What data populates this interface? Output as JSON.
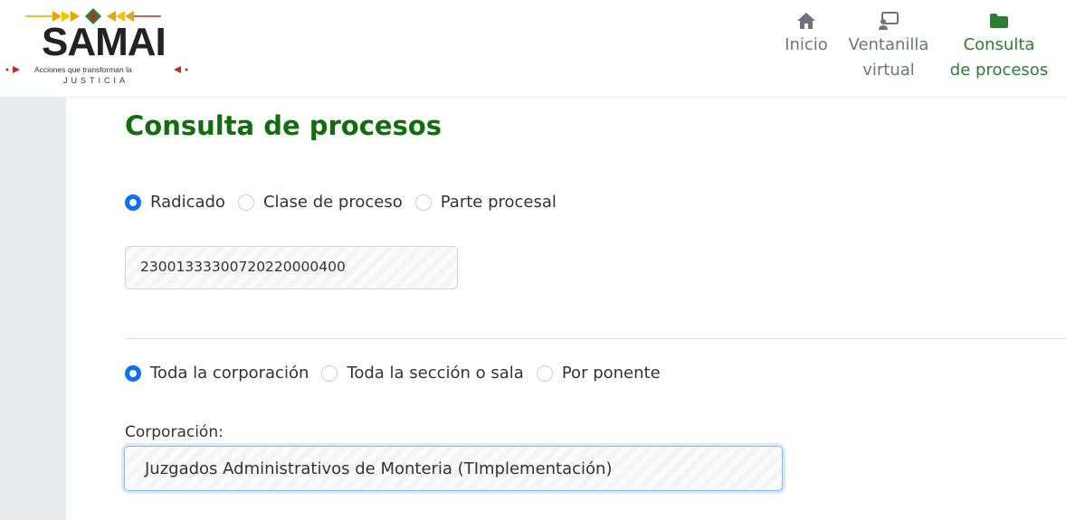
{
  "logo": {
    "title": "SAMAI",
    "tagline": "Acciones que transforman la",
    "subtitle": "JUSTICIA"
  },
  "nav": {
    "items": [
      {
        "label_line1": "Inicio",
        "label_line2": "",
        "icon": "home-icon",
        "active": false
      },
      {
        "label_line1": "Ventanilla",
        "label_line2": "virtual",
        "icon": "desktop-user-icon",
        "active": false
      },
      {
        "label_line1": "Consulta",
        "label_line2": "de procesos",
        "icon": "folder-icon",
        "active": true
      }
    ]
  },
  "page": {
    "title": "Consulta de procesos"
  },
  "search_type": {
    "options": [
      "Radicado",
      "Clase de proceso",
      "Parte procesal"
    ],
    "selected": "Radicado"
  },
  "radicado_input": {
    "value": "23001333300720220000400"
  },
  "scope": {
    "options": [
      "Toda la corporación",
      "Toda la sección o sala",
      "Por ponente"
    ],
    "selected": "Toda la corporación"
  },
  "corporacion": {
    "label": "Corporación:",
    "value": "Juzgados Administrativos de Monteria (TImplementación)"
  },
  "colors": {
    "accent_green": "#116d0e",
    "nav_active": "#2e7d32",
    "radio_checked": "#0d6efd",
    "nav_inactive": "#6c757d"
  }
}
